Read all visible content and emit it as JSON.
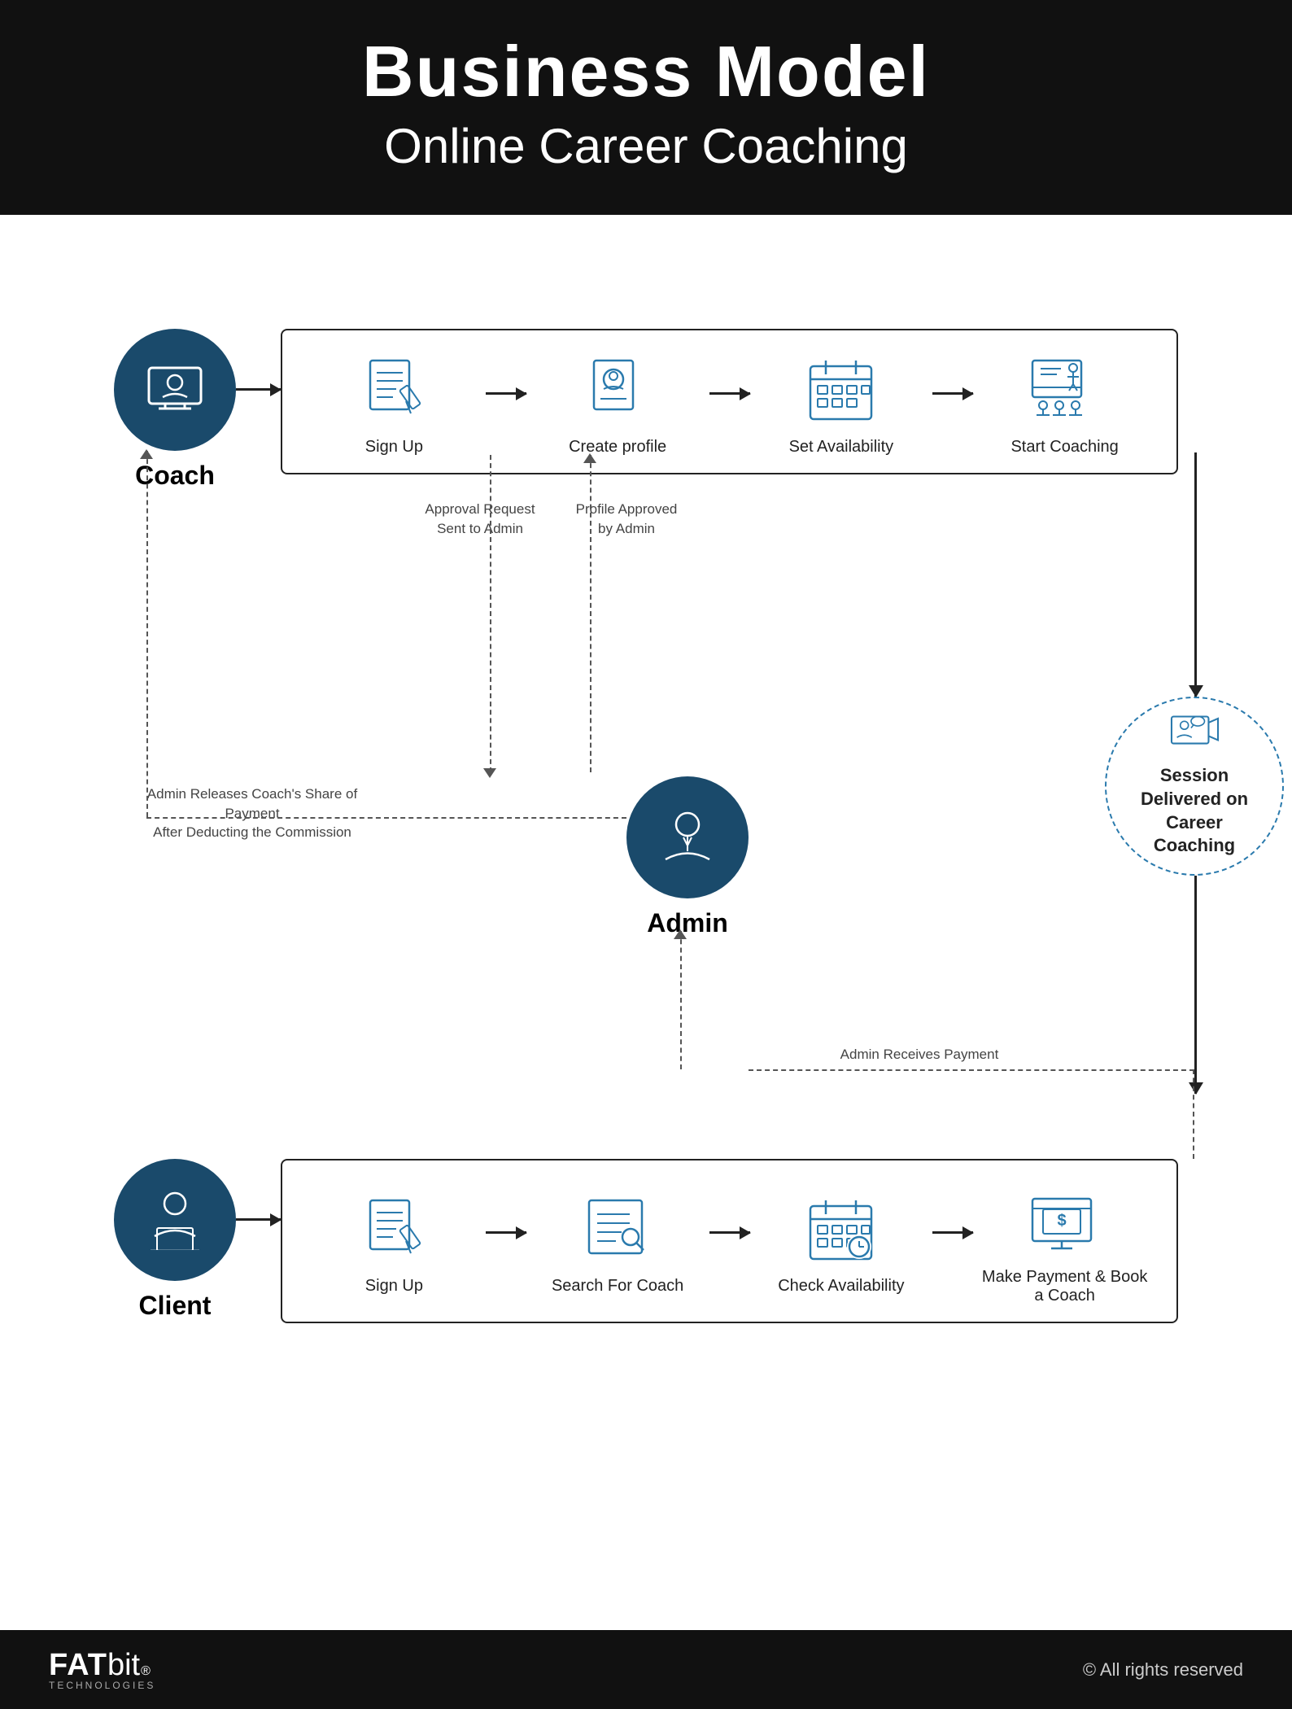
{
  "header": {
    "title": "Business Model",
    "subtitle": "Online Career Coaching"
  },
  "coach": {
    "label": "Coach",
    "steps": [
      {
        "id": "sign-up",
        "label": "Sign Up"
      },
      {
        "id": "create-profile",
        "label": "Create profile"
      },
      {
        "id": "set-availability",
        "label": "Set Availability"
      },
      {
        "id": "start-coaching",
        "label": "Start Coaching"
      }
    ]
  },
  "client": {
    "label": "Client",
    "steps": [
      {
        "id": "sign-up",
        "label": "Sign Up"
      },
      {
        "id": "search-coach",
        "label": "Search For Coach"
      },
      {
        "id": "check-availability",
        "label": "Check Availability"
      },
      {
        "id": "make-payment",
        "label": "Make Payment & Book a Coach"
      }
    ]
  },
  "admin": {
    "label": "Admin"
  },
  "session": {
    "label": "Session Delivered on Career Coaching"
  },
  "notes": {
    "approval_request": "Approval Request\nSent to Admin",
    "profile_approved": "Profile Approved\nby Admin",
    "admin_releases": "Admin Releases Coach's Share of Payment\nAfter Deducting the Commission",
    "admin_receives": "Admin Receives Payment"
  },
  "footer": {
    "logo_fat": "FAT",
    "logo_bit": "bit",
    "logo_sub": "TECHNOLOGIES",
    "copyright": "© All rights reserved"
  }
}
